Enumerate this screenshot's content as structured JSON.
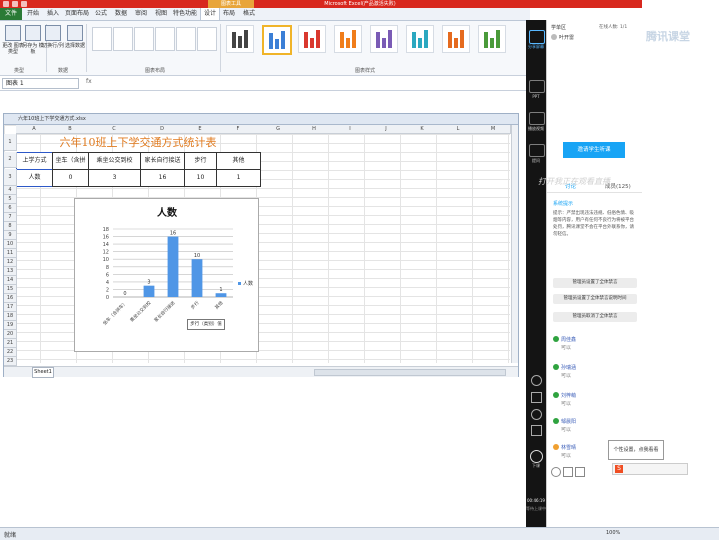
{
  "window": {
    "title": "Microsoft Excel(产品激活失败)",
    "context_tab": "图表工具"
  },
  "tabs": [
    "文件",
    "开始",
    "插入",
    "页面布局",
    "公式",
    "数据",
    "审阅",
    "视图",
    "特色功能",
    "设计",
    "布局",
    "格式"
  ],
  "ribbon": {
    "buttons": [
      {
        "label": "更改 图表类型",
        "icon": "chart-type-icon"
      },
      {
        "label": "另存为 模板",
        "icon": "save-template-icon"
      },
      {
        "label": "切换行/列",
        "icon": "switch-rowcol-icon"
      },
      {
        "label": "选择数据",
        "icon": "select-data-icon"
      }
    ],
    "groups": [
      "类型",
      "数据",
      "图表布局",
      "图表样式"
    ]
  },
  "formula_bar": {
    "name_box": "图表 1",
    "fx": "fx"
  },
  "workbook": {
    "title": "六年10班上下学交通方式.xlsx"
  },
  "columns": [
    "A",
    "B",
    "C",
    "D",
    "E",
    "F",
    "G",
    "H",
    "I",
    "J",
    "K",
    "L",
    "M",
    "N"
  ],
  "rows": [
    "1",
    "2",
    "3",
    "4",
    "5",
    "6",
    "7",
    "8",
    "9",
    "10",
    "11",
    "12",
    "13",
    "14",
    "15",
    "16",
    "17",
    "18",
    "19",
    "20",
    "21",
    "22",
    "23",
    "24"
  ],
  "table": {
    "title": "六年10班上下学交通方式统计表",
    "headers": [
      "上学方式",
      "坐车（含拼车）",
      "乘坐公交到校",
      "家长自行接送",
      "步行",
      "其他"
    ],
    "row": [
      "人数",
      "0",
      "3",
      "16",
      "10",
      "1"
    ]
  },
  "chart_data": {
    "type": "bar",
    "title": "人数",
    "categories": [
      "坐车（含拼车）",
      "乘坐公交到校",
      "家长自行接送",
      "步行",
      "其他"
    ],
    "series": [
      {
        "name": "人数",
        "values": [
          0,
          3,
          16,
          10,
          1
        ]
      }
    ],
    "ylim": [
      0,
      18
    ],
    "yticks": [
      "0",
      "2",
      "4",
      "6",
      "8",
      "10",
      "12",
      "14",
      "16",
      "18"
    ],
    "tooltip": "步行（类别）值",
    "colors": {
      "bar": "#4f96e6"
    }
  },
  "sheet_tab": "Sheet1",
  "statusbar": {
    "left": "就绪",
    "zoom": "100%"
  },
  "side_nav": [
    {
      "label": "分享屏幕",
      "icon": "share-screen-icon"
    },
    {
      "label": "PPT",
      "icon": "ppt-icon"
    },
    {
      "label": "播放视频",
      "icon": "play-video-icon"
    },
    {
      "label": "提问",
      "icon": "question-icon"
    }
  ],
  "side_bottom": {
    "timer": "00:46:19",
    "label": "等待上课中",
    "end_label": "下课"
  },
  "panel": {
    "room": "学单区",
    "people": "在线人数: 1/1",
    "teacher": "叶开雷",
    "invite_button": "邀请学生听课",
    "tabs": [
      "讨论",
      "成员(125)"
    ],
    "notice_title": "系统提示",
    "notice_text": "提示：严禁出现违法违规、低俗色情、吸烟等内容，用户有任何不良行为将被平台处罚，腾讯课堂不会在平台外联系你，请勿轻信。",
    "system_msgs": [
      "管理员设置了全体禁言",
      "管理员设置了全体禁言说明时间",
      "管理员取消了全体禁言"
    ],
    "chat": [
      {
        "name": "周佳鑫",
        "text": "可以"
      },
      {
        "name": "孙瑞涵",
        "text": "可以"
      },
      {
        "name": "刘梓萌",
        "text": "可以"
      },
      {
        "name": "邹晨阳",
        "text": "可以"
      },
      {
        "name": "林雪晴",
        "text": "可以"
      }
    ],
    "ime_tip": "个性设置，点我看看"
  },
  "watermark": "腾讯课堂",
  "live_overlay": "打开我正在观看直播",
  "bottom_button": "发送"
}
